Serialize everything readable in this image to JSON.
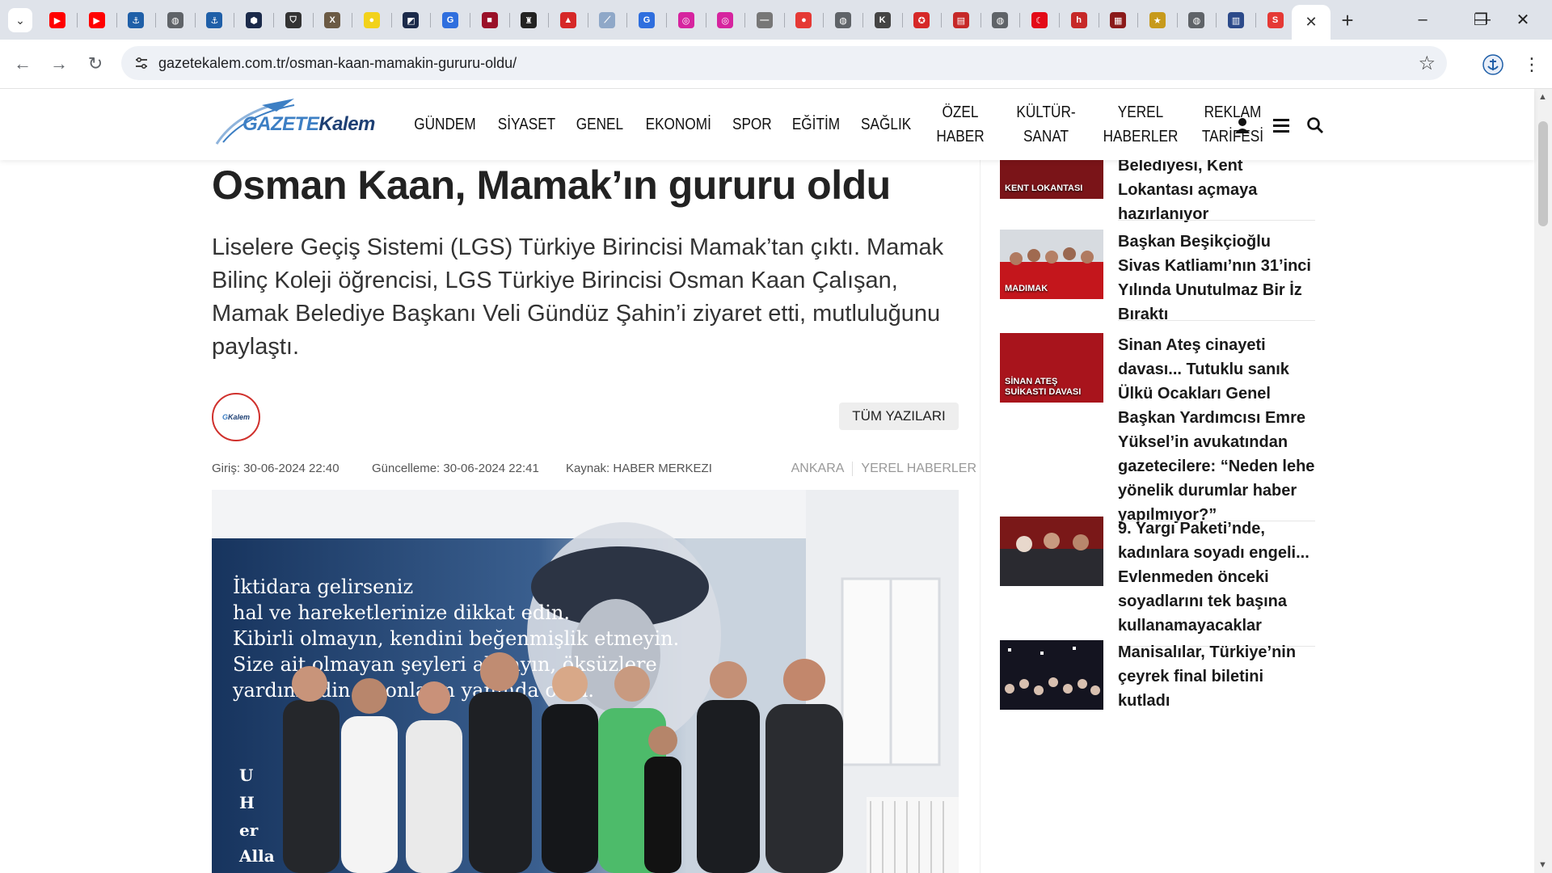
{
  "browser": {
    "url": "gazetekalem.com.tr/osman-kaan-mamakin-gururu-oldu/",
    "tabs": [
      {
        "icon": "youtube-icon",
        "color": "#ff0000",
        "glyph": "▶"
      },
      {
        "icon": "youtube-icon",
        "color": "#ff0000",
        "glyph": "▶"
      },
      {
        "icon": "anchor-icon",
        "color": "#1f5fa8",
        "glyph": "⚓"
      },
      {
        "icon": "globe-icon",
        "color": "#5f6368",
        "glyph": "◍"
      },
      {
        "icon": "anchor-icon",
        "color": "#1f5fa8",
        "glyph": "⚓"
      },
      {
        "icon": "hexagon-icon",
        "color": "#1b2a4a",
        "glyph": "⬢"
      },
      {
        "icon": "shield-icon",
        "color": "#333333",
        "glyph": "⛉"
      },
      {
        "icon": "x-letter-icon",
        "color": "#6b5a44",
        "glyph": "X"
      },
      {
        "icon": "yellow-circle-icon",
        "color": "#f2d21b",
        "glyph": "●"
      },
      {
        "icon": "slash-icon",
        "color": "#1b2a4a",
        "glyph": "◩"
      },
      {
        "icon": "g-letter-icon",
        "color": "#2f6fde",
        "glyph": "G"
      },
      {
        "icon": "news-icon",
        "color": "#9a1028",
        "glyph": "■"
      },
      {
        "icon": "badge-icon",
        "color": "#222222",
        "glyph": "♜"
      },
      {
        "icon": "mountain-icon",
        "color": "#d62828",
        "glyph": "▲"
      },
      {
        "icon": "feather-icon",
        "color": "#8fa8c8",
        "glyph": "⟋"
      },
      {
        "icon": "g-letter-icon",
        "color": "#2f6fde",
        "glyph": "G"
      },
      {
        "icon": "instagram-icon",
        "color": "#d6249f",
        "glyph": "◎"
      },
      {
        "icon": "instagram-icon",
        "color": "#d6249f",
        "glyph": "◎"
      },
      {
        "icon": "line-icon",
        "color": "#777777",
        "glyph": "—"
      },
      {
        "icon": "red-circle-icon",
        "color": "#e53935",
        "glyph": "●"
      },
      {
        "icon": "globe-icon",
        "color": "#5f6368",
        "glyph": "◍"
      },
      {
        "icon": "k-letter-icon",
        "color": "#444444",
        "glyph": "K"
      },
      {
        "icon": "red-badge-icon",
        "color": "#d62828",
        "glyph": "✪"
      },
      {
        "icon": "news-icon",
        "color": "#c62828",
        "glyph": "▤"
      },
      {
        "icon": "globe-icon",
        "color": "#5f6368",
        "glyph": "◍"
      },
      {
        "icon": "turkey-flag-icon",
        "color": "#e30a17",
        "glyph": "☾"
      },
      {
        "icon": "h-letter-icon",
        "color": "#c62828",
        "glyph": "h"
      },
      {
        "icon": "news-icon",
        "color": "#8b1a1a",
        "glyph": "▦"
      },
      {
        "icon": "star-badge-icon",
        "color": "#c79a1c",
        "glyph": "★"
      },
      {
        "icon": "globe-icon",
        "color": "#5f6368",
        "glyph": "◍"
      },
      {
        "icon": "news-icon",
        "color": "#2c4a8a",
        "glyph": "▥"
      },
      {
        "icon": "s-letter-icon",
        "color": "#e53935",
        "glyph": "S"
      }
    ]
  },
  "site": {
    "logo_a": "GAZETE",
    "logo_b": "Kalem",
    "nav": [
      {
        "label": "GÜNDEM",
        "name": "nav-item-gundem"
      },
      {
        "label": "SİYASET",
        "name": "nav-item-siyaset"
      },
      {
        "label": "GENEL",
        "name": "nav-item-genel"
      },
      {
        "label": "EKONOMİ",
        "name": "nav-item-ekonomi"
      },
      {
        "label": "SPOR",
        "name": "nav-item-spor"
      },
      {
        "label": "EĞİTİM",
        "name": "nav-item-egitim"
      },
      {
        "label": "SAĞLIK",
        "name": "nav-item-saglik"
      }
    ],
    "nav_twoline": [
      {
        "l1": "ÖZEL",
        "l2": "HABER",
        "name": "nav-item-ozel-haber"
      },
      {
        "l1": "KÜLTÜR-",
        "l2": "SANAT",
        "name": "nav-item-kultur-sanat"
      },
      {
        "l1": "YEREL",
        "l2": "HABERLER",
        "name": "nav-item-yerel-haberler"
      },
      {
        "l1": "REKLAM",
        "l2": "TARİFESİ",
        "name": "nav-item-reklam-tarifesi"
      }
    ]
  },
  "article": {
    "title": "Osman Kaan, Mamak’ın gururu oldu",
    "lead": "Liselere Geçiş Sistemi (LGS) Türkiye Birincisi Mamak’tan çıktı. Mamak Bilinç Koleji öğrencisi, LGS Türkiye Birincisi Osman Kaan Çalışan, Mamak Belediye Başkanı Veli Gündüz Şahin’i ziyaret etti, mutluluğunu paylaştı.",
    "all_posts": "TÜM YAZILARI",
    "entry": "Giriş: 30-06-2024 22:40",
    "updated": "Güncelleme: 30-06-2024 22:41",
    "source": "Kaynak: HABER MERKEZI",
    "cat1": "ANKARA",
    "cat2": "YEREL HABERLER",
    "image_text": [
      "İktidara gelirseniz",
      "hal ve hareketlerinize dikkat edin.",
      "Kibirli olmayın, kendini beğenmişlik etmeyin.",
      "Size ait olmayan şeyleri almayın, öksüzlere",
      "yardım edin ve onların yanında olun."
    ]
  },
  "sidebar": [
    {
      "title": "Manisa Büyükşehir Belediyesi, Kent Lokantası açmaya hazırlanıyor",
      "thumb_text": "KENT LOKANTASI"
    },
    {
      "title": "Başkan Beşikçioğlu Sivas Katliamı’nın 31’inci Yılında Unutulmaz Bir İz Bıraktı",
      "thumb_text": "MADIMAK"
    },
    {
      "title": "Sinan Ateş cinayeti davası... Tutuklu sanık Ülkü Ocakları Genel Başkan Yardımcısı Emre Yüksel’in avukatından gazetecilere: “Neden lehe yönelik durumlar haber yapılmıyor?”",
      "thumb_text": "SİNAN ATEŞ SUİKASTI DAVASI"
    },
    {
      "title": "9. Yargı Paketi’nde, kadınlara soyadı engeli... Evlenmeden önceki soyadlarını tek başına kullanamayacaklar",
      "thumb_text": ""
    },
    {
      "title": "Manisalılar, Türkiye’nin çeyrek final biletini kutladı",
      "thumb_text": ""
    }
  ]
}
